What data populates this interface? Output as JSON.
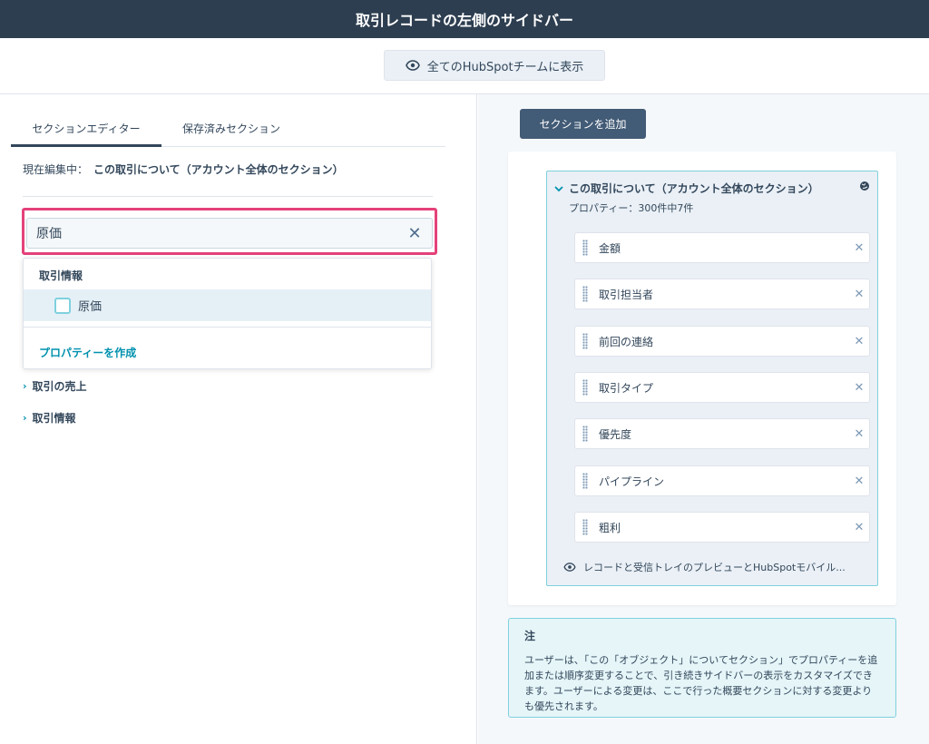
{
  "header": {
    "title": "取引レコードの左側のサイドバー"
  },
  "subbar": {
    "show_all_label": "全てのHubSpotチームに表示"
  },
  "left": {
    "tabs": [
      {
        "label": "セクションエディター"
      },
      {
        "label": "保存済みセクション"
      }
    ],
    "editing_label": "現在編集中：",
    "editing_value": "この取引について（アカウント全体のセクション）",
    "search": {
      "value": "原価",
      "placeholder": ""
    },
    "dropdown": {
      "group_label": "取引情報",
      "option_label": "原価",
      "create_label": "プロパティーを作成"
    },
    "collapsed_sections": [
      {
        "label": "取引の売上"
      },
      {
        "label": "取引情報"
      }
    ]
  },
  "right": {
    "add_section_label": "セクションを追加",
    "section": {
      "title": "この取引について（アカウント全体のセクション）",
      "subtitle": "プロパティー：300件中7件",
      "properties": [
        {
          "label": "金額"
        },
        {
          "label": "取引担当者"
        },
        {
          "label": "前回の連絡"
        },
        {
          "label": "取引タイプ"
        },
        {
          "label": "優先度"
        },
        {
          "label": "パイプライン"
        },
        {
          "label": "粗利"
        }
      ],
      "preview_label": "レコードと受信トレイのプレビューとHubSpotモバイル..."
    },
    "note": {
      "title": "注",
      "body": "ユーザーは、「この「オブジェクト」についてセクション」でプロパティーを追加または順序変更することで、引き続きサイドバーの表示をカスタマイズできます。ユーザーによる変更は、ここで行った概要セクションに対する変更よりも優先されます。"
    }
  },
  "icons": {
    "eye": "eye-icon",
    "close": "close-icon",
    "chevron_down": "chevron-down-icon",
    "chevron_right": "chevron-right-icon",
    "globe": "globe-icon",
    "drag": "drag-handle-icon"
  },
  "colors": {
    "topbar": "#2d3e50",
    "accent_link": "#0091ae",
    "highlight": "#e4417a",
    "panel_border": "#7fd1de",
    "primary_button": "#425b76"
  }
}
